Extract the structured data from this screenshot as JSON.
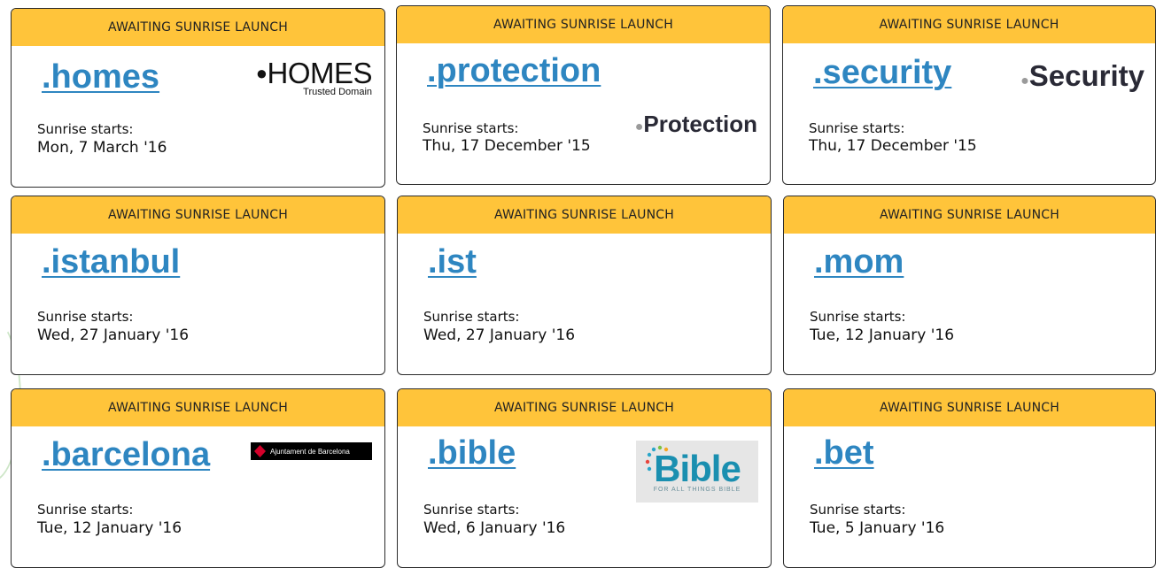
{
  "status_label": "AWAITING SUNRISE LAUNCH",
  "sunrise_label": "Sunrise starts:",
  "colors": {
    "header_bg": "#ffc43a",
    "tld_link": "#2e86c1",
    "border": "#2b2b2b"
  },
  "cards": [
    {
      "tld": ".homes",
      "date": "Mon, 7 March '16",
      "logo": {
        "type": "homes",
        "main": "HOMES",
        "sub": "Trusted Domain"
      }
    },
    {
      "tld": ".protection",
      "date": "Thu, 17 December '15",
      "logo": {
        "type": "protection",
        "text": "Protection"
      }
    },
    {
      "tld": ".security",
      "date": "Thu, 17 December '15",
      "logo": {
        "type": "security",
        "text": "Security"
      }
    },
    {
      "tld": ".istanbul",
      "date": "Wed, 27 January '16"
    },
    {
      "tld": ".ist",
      "date": "Wed, 27 January '16"
    },
    {
      "tld": ".mom",
      "date": "Tue, 12 January '16"
    },
    {
      "tld": ".barcelona",
      "date": "Tue, 12 January '16",
      "logo": {
        "type": "barcelona",
        "text": "Ajuntament de Barcelona"
      }
    },
    {
      "tld": ".bible",
      "date": "Wed, 6 January '16",
      "logo": {
        "type": "bible",
        "word": "Bible",
        "tag": "FOR ALL THINGS BIBLE"
      }
    },
    {
      "tld": ".bet",
      "date": "Tue, 5 January '16"
    }
  ]
}
